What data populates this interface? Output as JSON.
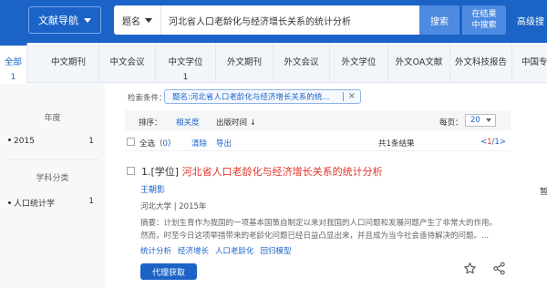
{
  "header": {
    "nav_label": "文献导航",
    "field_label": "题名",
    "search_value": "河北省人口老龄化与经济增长关系的统计分析",
    "search_btn": "搜索",
    "in_result_line1": "在结果",
    "in_result_line2": "中搜索",
    "advanced_label": "高级搜"
  },
  "tabs": [
    {
      "label": "全部",
      "count": "1"
    },
    {
      "label": "中文期刊",
      "count": ""
    },
    {
      "label": "中文会议",
      "count": ""
    },
    {
      "label": "中文学位",
      "count": "1"
    },
    {
      "label": "外文期刊",
      "count": ""
    },
    {
      "label": "外文会议",
      "count": ""
    },
    {
      "label": "外文学位",
      "count": ""
    },
    {
      "label": "外文OA文献",
      "count": ""
    },
    {
      "label": "外文科技报告",
      "count": ""
    },
    {
      "label": "中国专",
      "count": ""
    }
  ],
  "sidebar": {
    "year_title": "年度",
    "year_item": {
      "label": "2015",
      "count": "1"
    },
    "subject_title": "学科分类",
    "subject_item": {
      "label": "人口统计学",
      "count": "1"
    }
  },
  "conditions": {
    "label": "检索条件：",
    "tag": "题名:河北省人口老龄化与经济增长关系的统..."
  },
  "sort": {
    "label": "排序：",
    "relevance": "相关度",
    "time": "出版时间 ↓",
    "per_page_label": "每页：",
    "per_page_value": "20"
  },
  "selection": {
    "select_all": "全选（",
    "selected_count": "0",
    "select_all_end": "）",
    "clear": "清除",
    "export": "导出",
    "total_prefix": "共",
    "total_count": "1",
    "total_suffix": "条结果",
    "pager_current": "1",
    "pager_total": "/1",
    "pager_prev": "<",
    "pager_next": ">"
  },
  "result": {
    "prefix": "1.[学位] ",
    "title": "河北省人口老龄化与经济增长关系的统计分析",
    "author": "王朝影",
    "meta": "河北大学 | 2015年",
    "abstract_line1": "摘要：计划生育作为我国的一项基本国策自制定以来对我国的人口问题和发展问题产生了非常大的作用。",
    "abstract_line2": "然而，时至今日这项举措带来的老龄化问题已经日益凸显出来，并且成为当今社会亟待解决的问题。...",
    "keywords": [
      "统计分析",
      "经济增长",
      "人口老龄化",
      "回归模型"
    ],
    "proxy_btn": "代理获取",
    "right_cut": "暂"
  }
}
